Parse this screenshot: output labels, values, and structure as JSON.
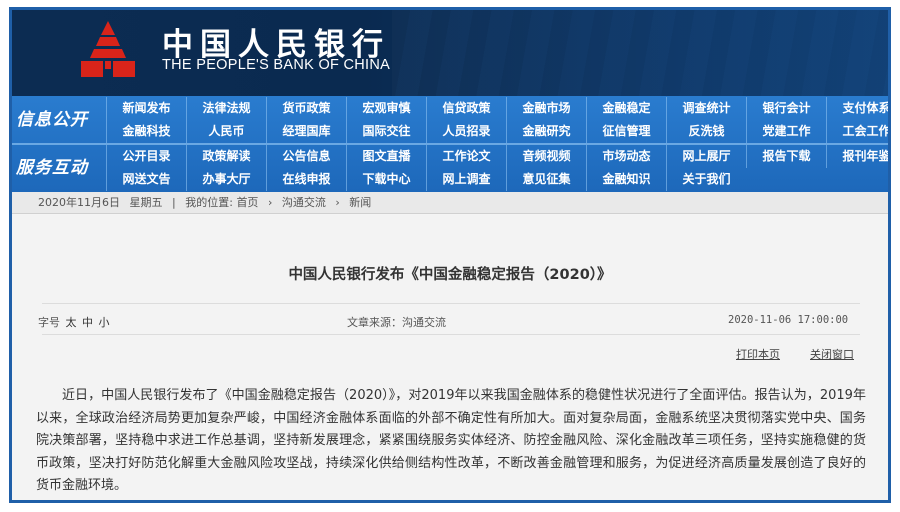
{
  "header": {
    "bank_name_cn": "中国人民银行",
    "bank_name_en": "THE PEOPLE'S BANK OF CHINA",
    "logo": "pboc-emblem-icon",
    "brand_color": "#0b2d55",
    "emblem_color": "#d9241a"
  },
  "nav": {
    "bar_color": "#2470c4",
    "groups": [
      {
        "label": "信息公开",
        "rows": [
          [
            "新闻发布",
            "法律法规",
            "货币政策",
            "宏观审慎",
            "信贷政策",
            "金融市场",
            "金融稳定",
            "调查统计",
            "银行会计",
            "支付体系"
          ],
          [
            "金融科技",
            "人民币",
            "经理国库",
            "国际交往",
            "人员招录",
            "金融研究",
            "征信管理",
            "反洗钱",
            "党建工作",
            "工会工作"
          ]
        ]
      },
      {
        "label": "服务互动",
        "rows": [
          [
            "公开目录",
            "政策解读",
            "公告信息",
            "图文直播",
            "工作论文",
            "音频视频",
            "市场动态",
            "网上展厅",
            "报告下载",
            "报刊年鉴"
          ],
          [
            "网送文告",
            "办事大厅",
            "在线申报",
            "下载中心",
            "网上调查",
            "意见征集",
            "金融知识",
            "关于我们"
          ]
        ]
      }
    ]
  },
  "breadcrumb": {
    "date": "2020年11月6日",
    "weekday": "星期五",
    "location_label": "我的位置:",
    "items": [
      "首页",
      "沟通交流",
      "新闻"
    ],
    "separator": "›"
  },
  "article": {
    "title": "中国人民银行发布《中国金融稳定报告（2020）》",
    "font_size_label": "字号",
    "font_sizes": [
      "太",
      "中",
      "小"
    ],
    "source": "文章来源：沟通交流",
    "datetime": "2020-11-06  17:00:00",
    "print_label": "打印本页",
    "close_label": "关闭窗口",
    "body": "近日，中国人民银行发布了《中国金融稳定报告（2020）》，对2019年以来我国金融体系的稳健性状况进行了全面评估。报告认为，2019年以来，全球政治经济局势更加复杂严峻，中国经济金融体系面临的外部不确定性有所加大。面对复杂局面，金融系统坚决贯彻落实党中央、国务院决策部署，坚持稳中求进工作总基调，坚持新发展理念，紧紧围绕服务实体经济、防控金融风险、深化金融改革三项任务，坚持实施稳健的货币政策，坚决打好防范化解重大金融风险攻坚战，持续深化供给侧结构性改革，不断改善金融管理和服务，为促进经济高质量发展创造了良好的货币金融环境。"
  }
}
